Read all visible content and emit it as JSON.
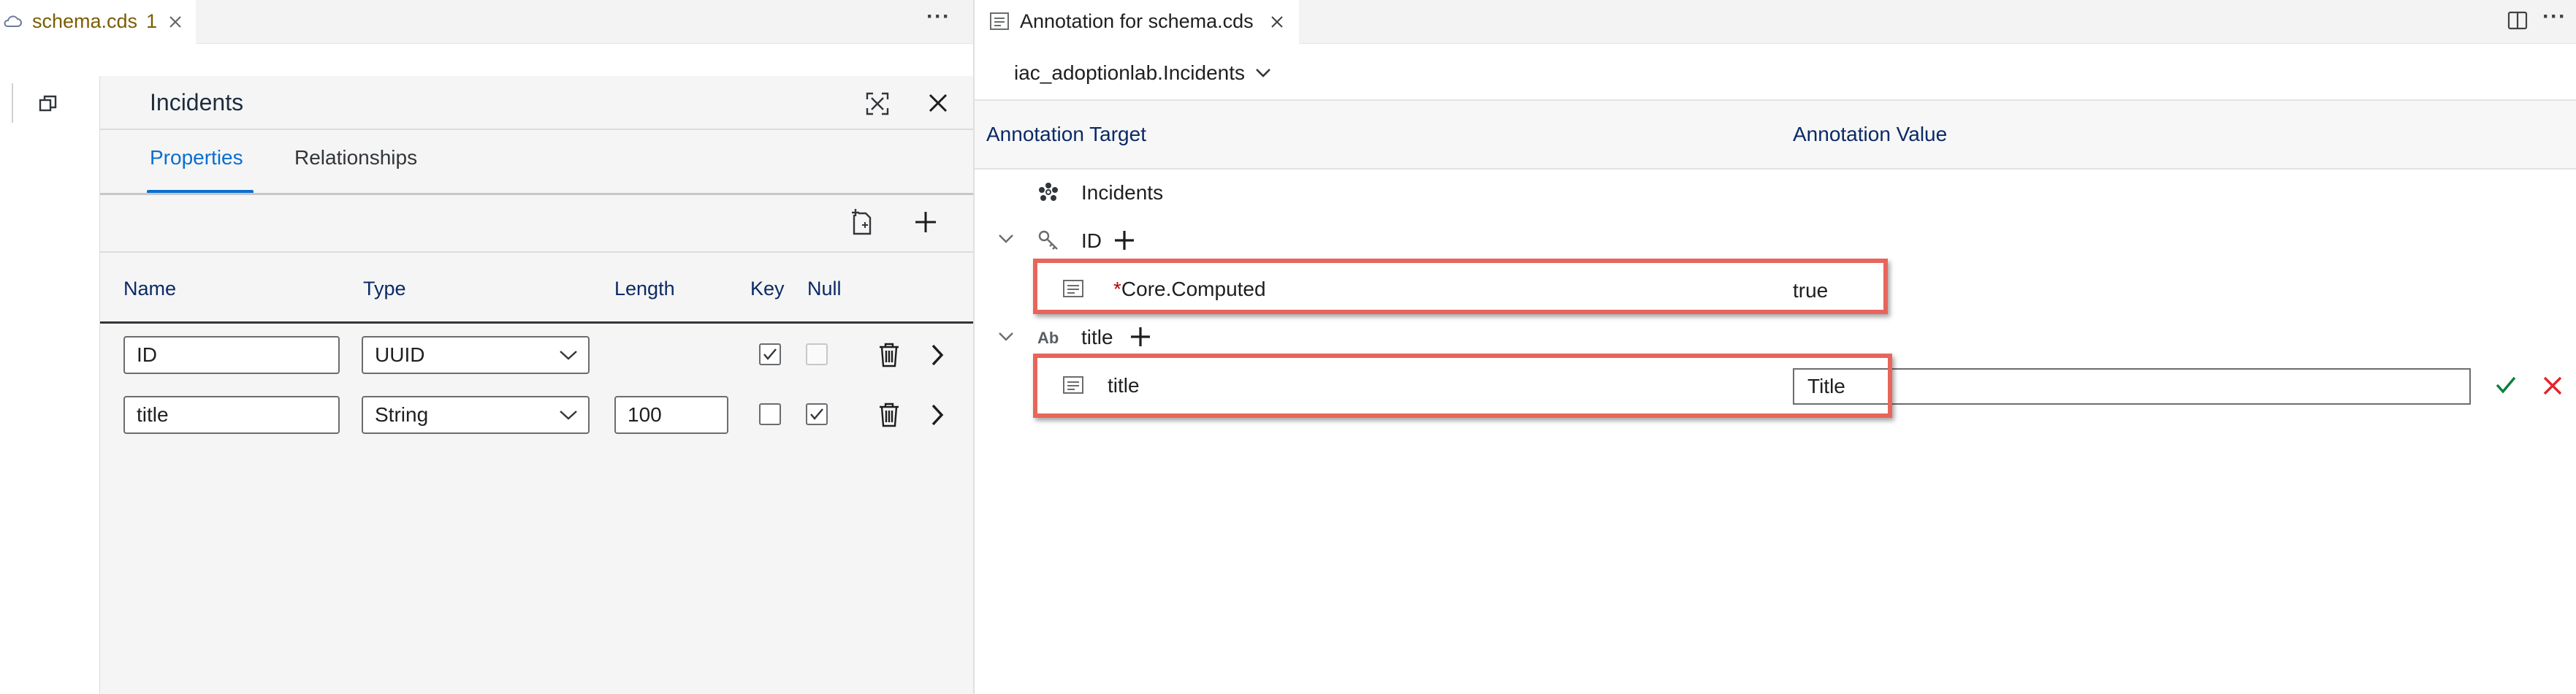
{
  "left_editor": {
    "tab": {
      "name": "schema.cds",
      "badge": "1"
    },
    "more_label": "···",
    "panel": {
      "title": "Incidents",
      "tabs": [
        {
          "label": "Properties",
          "active": true
        },
        {
          "label": "Relationships",
          "active": false
        }
      ],
      "columns": [
        "Name",
        "Type",
        "Length",
        "Key",
        "Null"
      ],
      "rows": [
        {
          "name": "ID",
          "type": "UUID",
          "length": "",
          "key": true,
          "null": false,
          "null_disabled": true
        },
        {
          "name": "title",
          "type": "String",
          "length": "100",
          "key": false,
          "null": true,
          "null_disabled": false
        }
      ]
    }
  },
  "right_editor": {
    "tab": {
      "name": "Annotation for schema.cds"
    },
    "more_label": "···",
    "entity_selector": "iac_adoptionlab.Incidents",
    "headers": {
      "target": "Annotation Target",
      "value": "Annotation Value"
    },
    "tree": {
      "entity": "Incidents",
      "id_node": "ID",
      "id_annotation": {
        "required_marker": "*",
        "term": "Core.Computed",
        "value": "true"
      },
      "title_node_type": "Ab",
      "title_node": "title",
      "title_annotation": {
        "term": "title",
        "value": "Title"
      }
    }
  },
  "colors": {
    "accent_blue": "#0a6ed1",
    "header_navy": "#0a2a66",
    "highlight_red": "#e8655b",
    "accept_green": "#107e3e",
    "cancel_red": "#e3242b",
    "required_red": "#bb0000"
  }
}
